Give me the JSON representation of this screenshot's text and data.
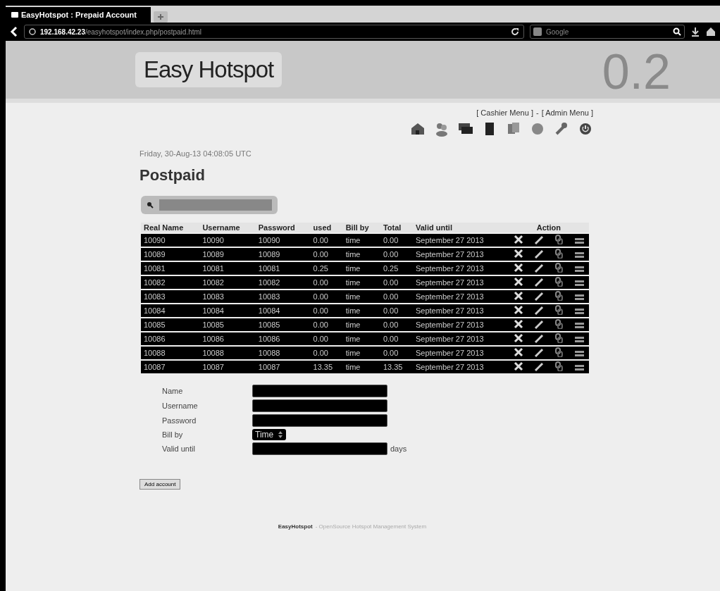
{
  "browser": {
    "tab_title": "EasyHotspot : Prepaid Account",
    "url_host": "192.168.42.23",
    "url_path": "/easyhotspot/index.php/postpaid.html",
    "search_placeholder": "Google"
  },
  "header": {
    "logo": "Easy Hotspot",
    "version": "0.2"
  },
  "top_links": [
    "[ Cashier Menu ]",
    "-",
    "[ Admin Menu ]"
  ],
  "date": "Friday, 30-Aug-13 04:08:05 UTC",
  "title": "Postpaid",
  "table": {
    "columns": [
      "Real Name",
      "Username",
      "Password",
      "used",
      "Bill by",
      "Total",
      "Valid until",
      "Action"
    ],
    "rows": [
      {
        "cells": [
          "10090",
          "10090",
          "10090",
          "0.00",
          "time",
          "0.00",
          "September 27 2013"
        ]
      },
      {
        "cells": [
          "10089",
          "10089",
          "10089",
          "0.00",
          "time",
          "0.00",
          "September 27 2013"
        ]
      },
      {
        "cells": [
          "10081",
          "10081",
          "10081",
          "0.25",
          "time",
          "0.25",
          "September 27 2013"
        ]
      },
      {
        "cells": [
          "10082",
          "10082",
          "10082",
          "0.00",
          "time",
          "0.00",
          "September 27 2013"
        ]
      },
      {
        "cells": [
          "10083",
          "10083",
          "10083",
          "0.00",
          "time",
          "0.00",
          "September 27 2013"
        ]
      },
      {
        "cells": [
          "10084",
          "10084",
          "10084",
          "0.00",
          "time",
          "0.00",
          "September 27 2013"
        ]
      },
      {
        "cells": [
          "10085",
          "10085",
          "10085",
          "0.00",
          "time",
          "0.00",
          "September 27 2013"
        ]
      },
      {
        "cells": [
          "10086",
          "10086",
          "10086",
          "0.00",
          "time",
          "0.00",
          "September 27 2013"
        ]
      },
      {
        "cells": [
          "10088",
          "10088",
          "10088",
          "0.00",
          "time",
          "0.00",
          "September 27 2013"
        ]
      },
      {
        "cells": [
          "10087",
          "10087",
          "10087",
          "13.35",
          "time",
          "13.35",
          "September 27 2013"
        ]
      }
    ]
  },
  "form": [
    {
      "label": "Name",
      "kind": "text"
    },
    {
      "label": "Username",
      "kind": "text"
    },
    {
      "label": "Password",
      "kind": "text"
    },
    {
      "label": "Bill by",
      "kind": "select",
      "value": "Time"
    },
    {
      "label": "Valid until",
      "kind": "text",
      "suffix": "days"
    }
  ],
  "submit": "Add account",
  "footer": {
    "brand": "EasyHotspot",
    "text": "- OpenSource Hotspot Management System"
  }
}
